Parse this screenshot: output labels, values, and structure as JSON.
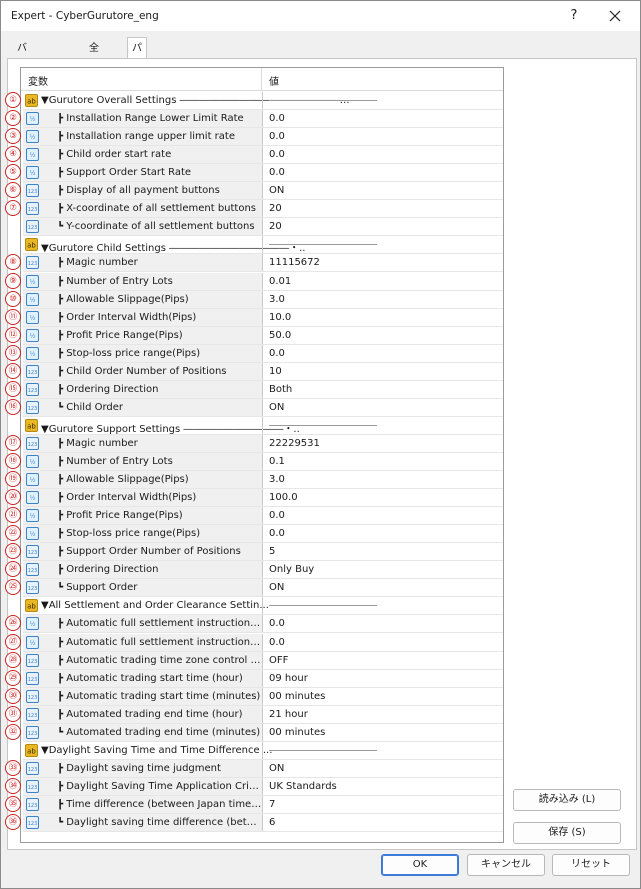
{
  "window": {
    "title": "Expert - CyberGurutore_eng",
    "help": "?"
  },
  "tabs": [
    {
      "label": "バージョン情報",
      "active": false
    },
    {
      "label": "全般",
      "active": false
    },
    {
      "label": "パラメーターの入力",
      "active": true
    }
  ],
  "grid": {
    "header_variable": "変数",
    "header_value": "値",
    "rows": [
      {
        "kind": "section",
        "icon": "ab",
        "label": "▼Gurutore Overall Settings ――――――――――――――――…",
        "value": "",
        "badge": "①"
      },
      {
        "kind": "param",
        "icon": "v2",
        "label": "┣ Installation Range Lower Limit Rate",
        "value": "0.0",
        "badge": "②"
      },
      {
        "kind": "param",
        "icon": "v2",
        "label": "┣ Installation range upper limit rate",
        "value": "0.0",
        "badge": "③"
      },
      {
        "kind": "param",
        "icon": "v2",
        "label": "┣ Child order start rate",
        "value": "0.0",
        "badge": "④"
      },
      {
        "kind": "param",
        "icon": "v2",
        "label": "┣ Support Order Start Rate",
        "value": "0.0",
        "badge": "⑤"
      },
      {
        "kind": "param",
        "icon": "123",
        "label": "┣ Display of all payment buttons",
        "value": "ON",
        "badge": "⑥"
      },
      {
        "kind": "param",
        "icon": "123",
        "label": "┣ X-coordinate of all settlement buttons",
        "value": "20",
        "badge": "⑦"
      },
      {
        "kind": "param",
        "icon": "123",
        "label": "┗ Y-coordinate of all settlement buttons",
        "value": "20",
        "badge": ""
      },
      {
        "kind": "section",
        "icon": "ab",
        "label": "▼Gurutore Child Settings ――――――――――――・..",
        "value": "",
        "badge": ""
      },
      {
        "kind": "param",
        "icon": "123",
        "label": "┣ Magic number",
        "value": "11115672",
        "badge": "⑧"
      },
      {
        "kind": "param",
        "icon": "v2",
        "label": "┣ Number of Entry Lots",
        "value": "0.01",
        "badge": "⑨"
      },
      {
        "kind": "param",
        "icon": "v2",
        "label": "┣ Allowable Slippage(Pips)",
        "value": "3.0",
        "badge": "⑩"
      },
      {
        "kind": "param",
        "icon": "v2",
        "label": "┣ Order Interval Width(Pips)",
        "value": "10.0",
        "badge": "⑪"
      },
      {
        "kind": "param",
        "icon": "v2",
        "label": "┣ Profit Price Range(Pips)",
        "value": "50.0",
        "badge": "⑫"
      },
      {
        "kind": "param",
        "icon": "v2",
        "label": "┣ Stop-loss price range(Pips)",
        "value": "0.0",
        "badge": "⑬"
      },
      {
        "kind": "param",
        "icon": "123",
        "label": "┣ Child Order Number of Positions",
        "value": "10",
        "badge": "⑭"
      },
      {
        "kind": "param",
        "icon": "123",
        "label": "┣ Ordering Direction",
        "value": "Both",
        "badge": "⑮"
      },
      {
        "kind": "param",
        "icon": "123",
        "label": "┗ Child Order",
        "value": "ON",
        "badge": "⑯"
      },
      {
        "kind": "section",
        "icon": "ab",
        "label": "▼Gurutore Support Settings ――――――――――・..",
        "value": "",
        "badge": ""
      },
      {
        "kind": "param",
        "icon": "123",
        "label": "┣ Magic number",
        "value": "22229531",
        "badge": "⑰"
      },
      {
        "kind": "param",
        "icon": "v2",
        "label": "┣ Number of Entry Lots",
        "value": "0.1",
        "badge": "⑱"
      },
      {
        "kind": "param",
        "icon": "v2",
        "label": "┣ Allowable Slippage(Pips)",
        "value": "3.0",
        "badge": "⑲"
      },
      {
        "kind": "param",
        "icon": "v2",
        "label": "┣ Order Interval Width(Pips)",
        "value": "100.0",
        "badge": "⑳"
      },
      {
        "kind": "param",
        "icon": "v2",
        "label": "┣ Profit Price Range(Pips)",
        "value": "0.0",
        "badge": "㉑"
      },
      {
        "kind": "param",
        "icon": "v2",
        "label": "┣ Stop-loss price range(Pips)",
        "value": "0.0",
        "badge": "㉒"
      },
      {
        "kind": "param",
        "icon": "123",
        "label": "┣ Support Order Number of Positions",
        "value": "5",
        "badge": "㉓"
      },
      {
        "kind": "param",
        "icon": "123",
        "label": "┣ Ordering Direction",
        "value": "Only Buy",
        "badge": "㉔"
      },
      {
        "kind": "param",
        "icon": "123",
        "label": "┗ Support Order",
        "value": "ON",
        "badge": "㉕"
      },
      {
        "kind": "section",
        "icon": "ab",
        "label": "▼All Settlement and Order Clearance Settin...",
        "value": "",
        "badge": ""
      },
      {
        "kind": "param",
        "icon": "v2",
        "label": "┣ Automatic full settlement instruction rate...",
        "value": "0.0",
        "badge": "㉖"
      },
      {
        "kind": "param",
        "icon": "v2",
        "label": "┣ Automatic full settlement instruction rate...",
        "value": "0.0",
        "badge": "㉗"
      },
      {
        "kind": "param",
        "icon": "123",
        "label": "┣ Automatic trading time zone control (OFF...",
        "value": "OFF",
        "badge": "㉘"
      },
      {
        "kind": "param",
        "icon": "123",
        "label": "┣ Automatic trading start time (hour)",
        "value": "09 hour",
        "badge": "㉙"
      },
      {
        "kind": "param",
        "icon": "123",
        "label": "┣ Automatic trading start time (minutes)",
        "value": "00 minutes",
        "badge": "㉚"
      },
      {
        "kind": "param",
        "icon": "123",
        "label": "┣ Automated trading end time (hour)",
        "value": "21 hour",
        "badge": "㉛"
      },
      {
        "kind": "param",
        "icon": "123",
        "label": "┗ Automated trading end time (minutes)",
        "value": "00 minutes",
        "badge": "㉜"
      },
      {
        "kind": "section",
        "icon": "ab",
        "label": "▼Daylight Saving Time and Time Difference ...",
        "value": "",
        "badge": ""
      },
      {
        "kind": "param",
        "icon": "123",
        "label": "┣ Daylight saving time judgment",
        "value": "ON",
        "badge": "㉝"
      },
      {
        "kind": "param",
        "icon": "123",
        "label": "┣ Daylight Saving Time Application Criteria ...",
        "value": "UK Standards",
        "badge": "㉞"
      },
      {
        "kind": "param",
        "icon": "123",
        "label": "┣ Time difference (between Japan time and ...",
        "value": "7",
        "badge": "㉟"
      },
      {
        "kind": "param",
        "icon": "123",
        "label": "┗ Daylight saving time difference (between ...",
        "value": "6",
        "badge": "㊱"
      }
    ]
  },
  "buttons": {
    "load": "読み込み (L)",
    "save": "保存 (S)",
    "ok": "OK",
    "cancel": "キャンセル",
    "reset": "リセット"
  },
  "colors": {
    "badge": "#cc2222",
    "accent": "#3c7bd9",
    "icon_ab": "#e9b824",
    "icon_num": "#3b83c8"
  }
}
